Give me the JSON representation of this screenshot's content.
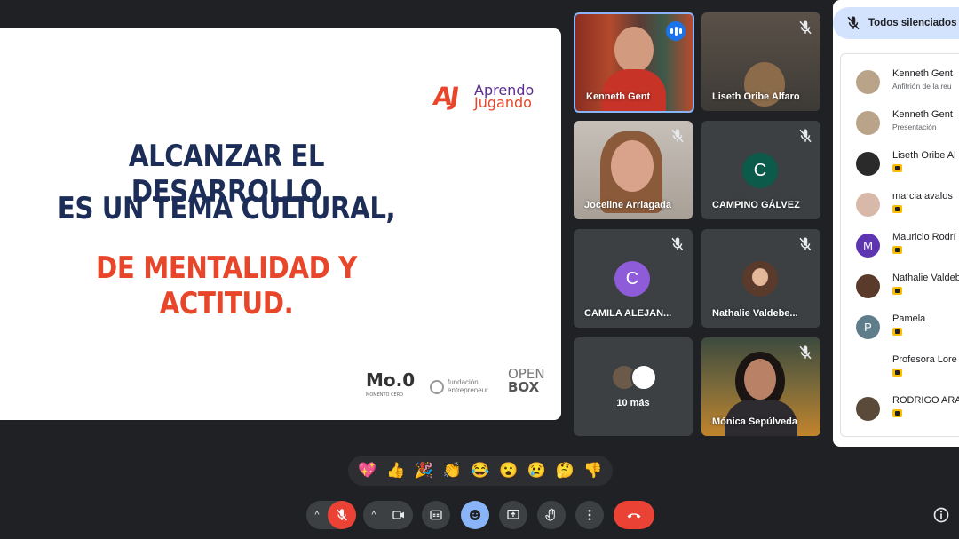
{
  "slide": {
    "brand_line1": "Aprendo",
    "brand_line2": "Jugando",
    "heading_line1": "ALCANZAR EL DESARROLLO",
    "heading_line2": "ES UN TEMA CULTURAL,",
    "heading_line3": "DE MENTALIDAD Y ACTITUD.",
    "logo1": "Mo.0",
    "logo1_sub": "MOMENTO CERO",
    "logo2_line1": "fundación",
    "logo2_line2": "entrepreneur",
    "logo3_line1": "OPEN",
    "logo3_line2": "BOX"
  },
  "tiles": {
    "t1": "Kenneth Gent",
    "t2": "Liseth Oribe Alfaro",
    "t3": "Joceline Arriagada",
    "t4": "CAMPINO GÁLVEZ",
    "t4_initial": "C",
    "t5": "CAMILA ALEJAN...",
    "t5_initial": "C",
    "t6": "Nathalie Valdebe...",
    "t7": "10 más",
    "t8": "Mónica Sepúlveda"
  },
  "panel": {
    "mute_all": "Todos silenciados",
    "participants": [
      {
        "name": "Kenneth Gent",
        "sub": "Anfitrión de la reu"
      },
      {
        "name": "Kenneth Gent",
        "sub": "Presentación"
      },
      {
        "name": "Liseth Oribe Al",
        "sub": ""
      },
      {
        "name": "marcia avalos",
        "sub": ""
      },
      {
        "name": "Mauricio Rodrí",
        "sub": "",
        "initial": "M"
      },
      {
        "name": "Nathalie Valdeb",
        "sub": ""
      },
      {
        "name": "Pamela",
        "sub": "",
        "initial": "P"
      },
      {
        "name": "Profesora Lore",
        "sub": ""
      },
      {
        "name": "RODRIGO ARA",
        "sub": ""
      }
    ]
  },
  "reactions": [
    "💖",
    "👍",
    "🎉",
    "👏",
    "😂",
    "😮",
    "😢",
    "🤔",
    "👎"
  ],
  "colors": {
    "background": "#202124",
    "accent_blue": "#1a73e8",
    "hangup_red": "#ea4335",
    "brand_orange": "#e8462a",
    "brand_navy": "#1c2d57"
  }
}
